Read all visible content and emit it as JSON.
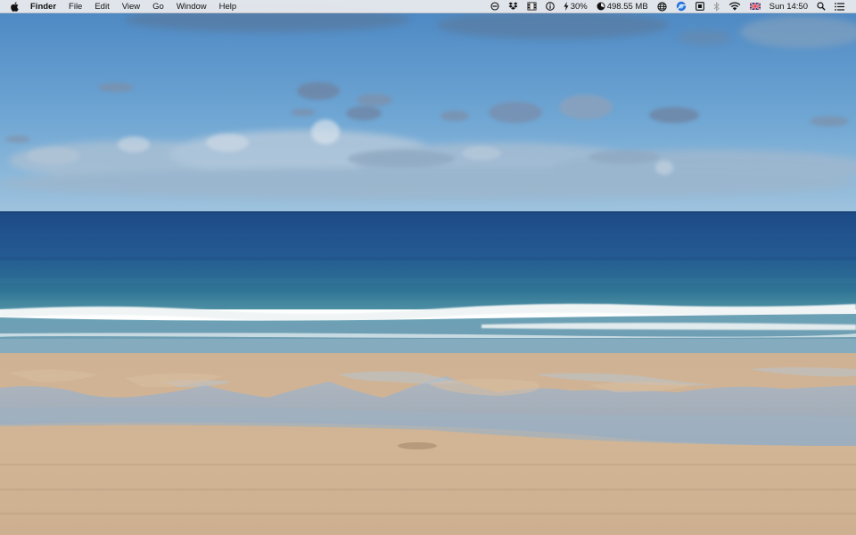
{
  "menubar": {
    "app_menu": "Finder",
    "menus": [
      "File",
      "Edit",
      "View",
      "Go",
      "Window",
      "Help"
    ],
    "status": {
      "battery_percent": "30%",
      "memory": "498.55 MB",
      "clock": "Sun 14:50"
    },
    "icons": [
      "do-not-disturb-icon",
      "dropbox-icon",
      "filmstrip-icon",
      "info-icon",
      "battery-bolt-icon",
      "memory-gauge-icon",
      "globe-icon",
      "browser-icon",
      "screen-icon",
      "bluetooth-icon",
      "wifi-icon",
      "uk-flag-icon",
      "spotlight-search-icon",
      "notification-center-icon"
    ]
  },
  "wallpaper": {
    "subject": "beach-seascape",
    "colors": {
      "sky_top": "#4f8cc6",
      "sky_horizon": "#9fc4df",
      "sea_deep": "#1f4f8f",
      "sea_shallow": "#3f7fa6",
      "foam": "#f2f5f5",
      "sand": "#cdb08e",
      "wet_sand": "#9aa8b8"
    }
  }
}
